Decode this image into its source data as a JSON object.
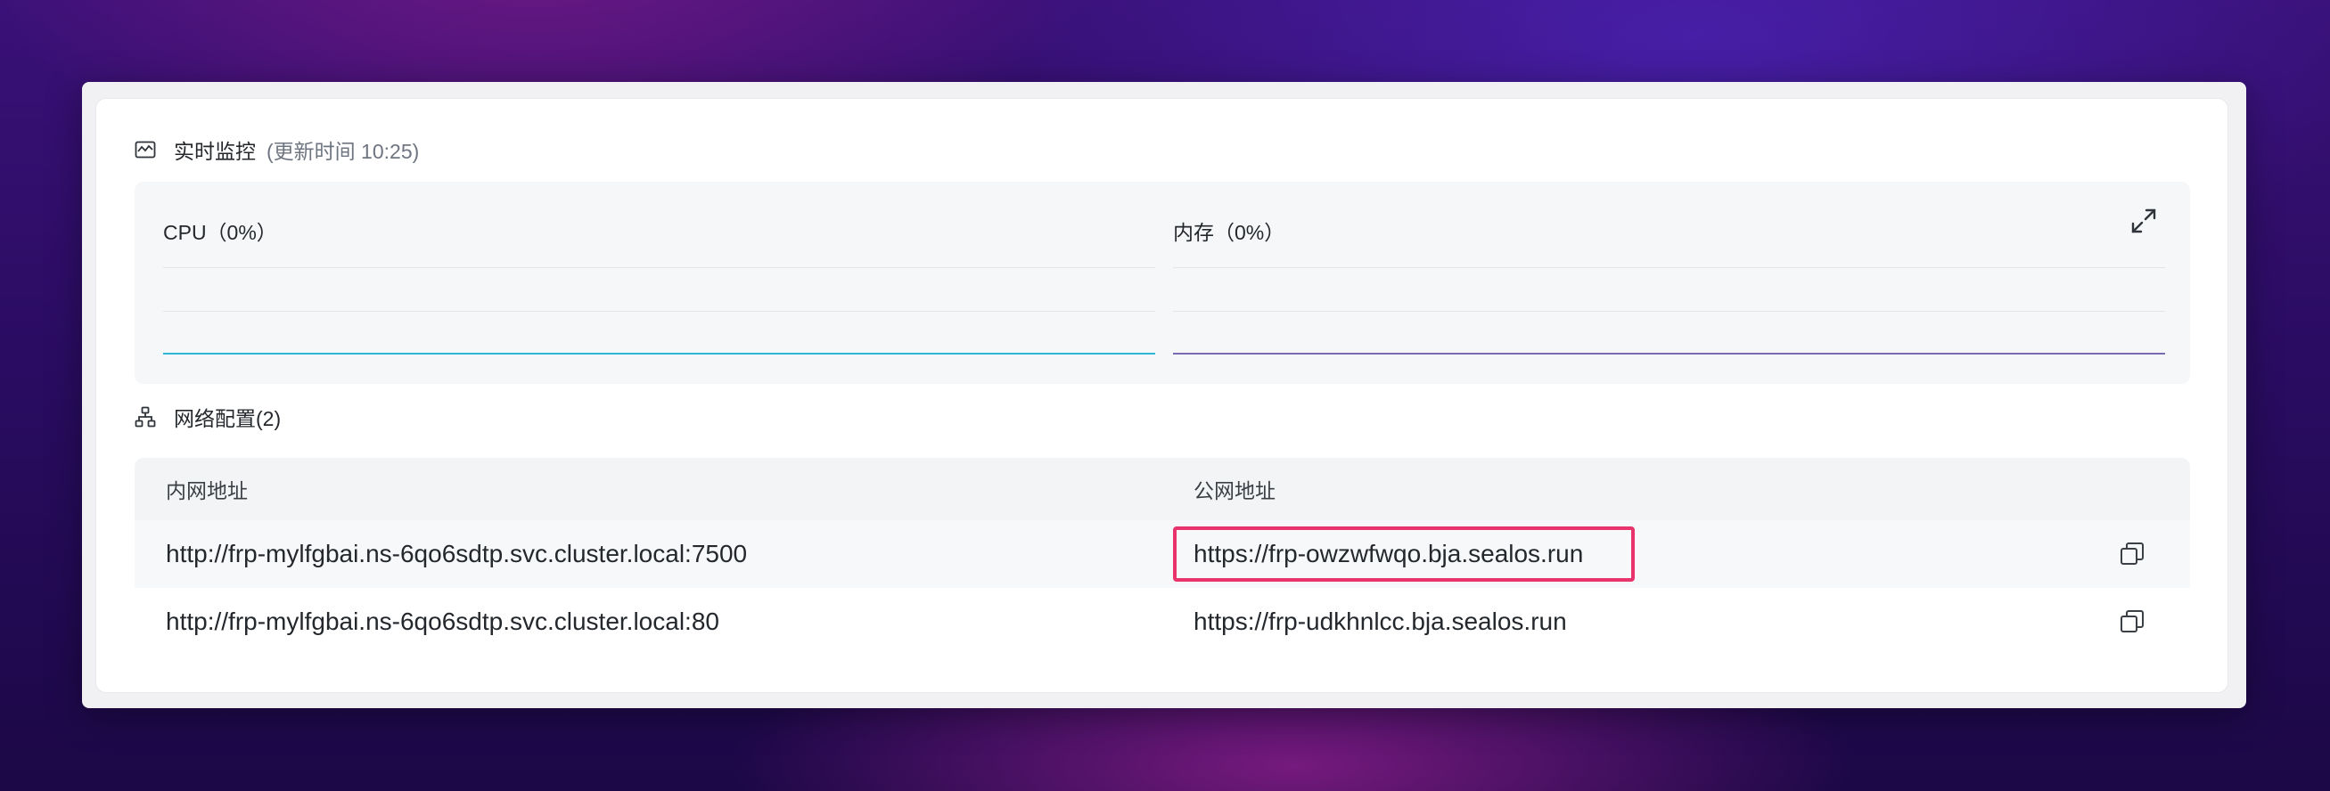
{
  "monitor": {
    "icon": "monitor-icon",
    "title": "实时监控",
    "updated": "(更新时间  10:25)",
    "cpu": {
      "label": "CPU（0%）",
      "value_percent": 0,
      "color": "#2fb5d8"
    },
    "memory": {
      "label": "内存（0%）",
      "value_percent": 0,
      "color": "#7a6bb0"
    },
    "expand_icon": "expand-icon"
  },
  "network": {
    "icon": "network-icon",
    "title": "网络配置(2)",
    "columns": {
      "internal": "内网地址",
      "public": "公网地址"
    },
    "rows": [
      {
        "internal": "http://frp-mylfgbai.ns-6qo6sdtp.svc.cluster.local:7500",
        "public": "https://frp-owzwfwqo.bja.sealos.run",
        "highlighted": true,
        "copy_icon": "copy-icon"
      },
      {
        "internal": "http://frp-mylfgbai.ns-6qo6sdtp.svc.cluster.local:80",
        "public": "https://frp-udkhnlcc.bja.sealos.run",
        "highlighted": false,
        "copy_icon": "copy-icon"
      }
    ],
    "highlight_color": "#e8336d"
  }
}
